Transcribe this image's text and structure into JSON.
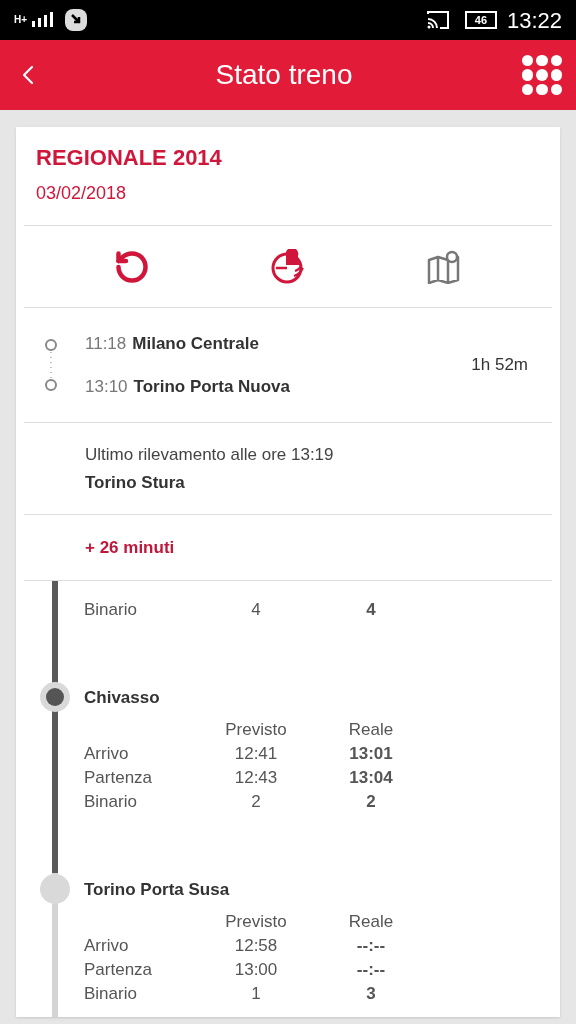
{
  "status_bar": {
    "network": "H+",
    "battery": "46",
    "time": "13:22"
  },
  "header": {
    "title": "Stato treno"
  },
  "train": {
    "name": "REGIONALE 2014",
    "date": "03/02/2018"
  },
  "route": {
    "departure": {
      "time": "11:18",
      "station": "Milano Centrale"
    },
    "arrival": {
      "time": "13:10",
      "station": "Torino Porta Nuova"
    },
    "duration": "1h 52m"
  },
  "last_seen": {
    "text": "Ultimo rilevamento alle ore 13:19",
    "station": "Torino Stura"
  },
  "delay": "+ 26 minuti",
  "stops": [
    {
      "passed": true,
      "rows": [
        {
          "label": "Binario",
          "planned": "4",
          "actual": "4"
        }
      ]
    },
    {
      "name": "Chivasso",
      "passed": true,
      "planned_header": "Previsto",
      "actual_header": "Reale",
      "rows": [
        {
          "label": "Arrivo",
          "planned": "12:41",
          "actual": "13:01"
        },
        {
          "label": "Partenza",
          "planned": "12:43",
          "actual": "13:04"
        },
        {
          "label": "Binario",
          "planned": "2",
          "actual": "2"
        }
      ]
    },
    {
      "name": "Torino Porta Susa",
      "passed": false,
      "planned_header": "Previsto",
      "actual_header": "Reale",
      "rows": [
        {
          "label": "Arrivo",
          "planned": "12:58",
          "actual": "--:--"
        },
        {
          "label": "Partenza",
          "planned": "13:00",
          "actual": "--:--"
        },
        {
          "label": "Binario",
          "planned": "1",
          "actual": "3"
        }
      ]
    }
  ]
}
